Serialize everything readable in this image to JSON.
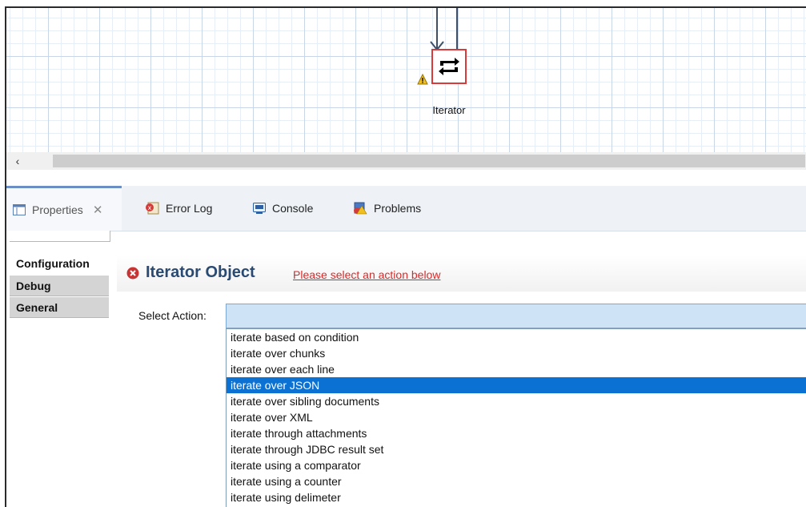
{
  "canvas": {
    "node_label": "Iterator"
  },
  "tabs": [
    {
      "label": "Properties",
      "icon": "properties-icon",
      "active": true
    },
    {
      "label": "Error Log",
      "icon": "error-log-icon"
    },
    {
      "label": "Console",
      "icon": "console-icon"
    },
    {
      "label": "Problems",
      "icon": "problems-icon"
    }
  ],
  "side_tabs": [
    {
      "label": "Configuration",
      "selected": true
    },
    {
      "label": "Debug"
    },
    {
      "label": "General"
    }
  ],
  "header": {
    "title": "Iterator Object",
    "link": "Please select an action below"
  },
  "form": {
    "select_label": "Select Action:",
    "select_value": ""
  },
  "dropdown": {
    "options": [
      "iterate based on condition",
      "iterate over chunks",
      "iterate over each line",
      "iterate over JSON",
      "iterate over sibling documents",
      "iterate over XML",
      "iterate through attachments",
      "iterate through JDBC result set",
      "iterate using a comparator",
      "iterate using a counter",
      "iterate using delimeter"
    ],
    "selected_index": 3
  },
  "colors": {
    "accent": "#0b72d3",
    "error": "#d52b2b",
    "title": "#2a4a72"
  }
}
